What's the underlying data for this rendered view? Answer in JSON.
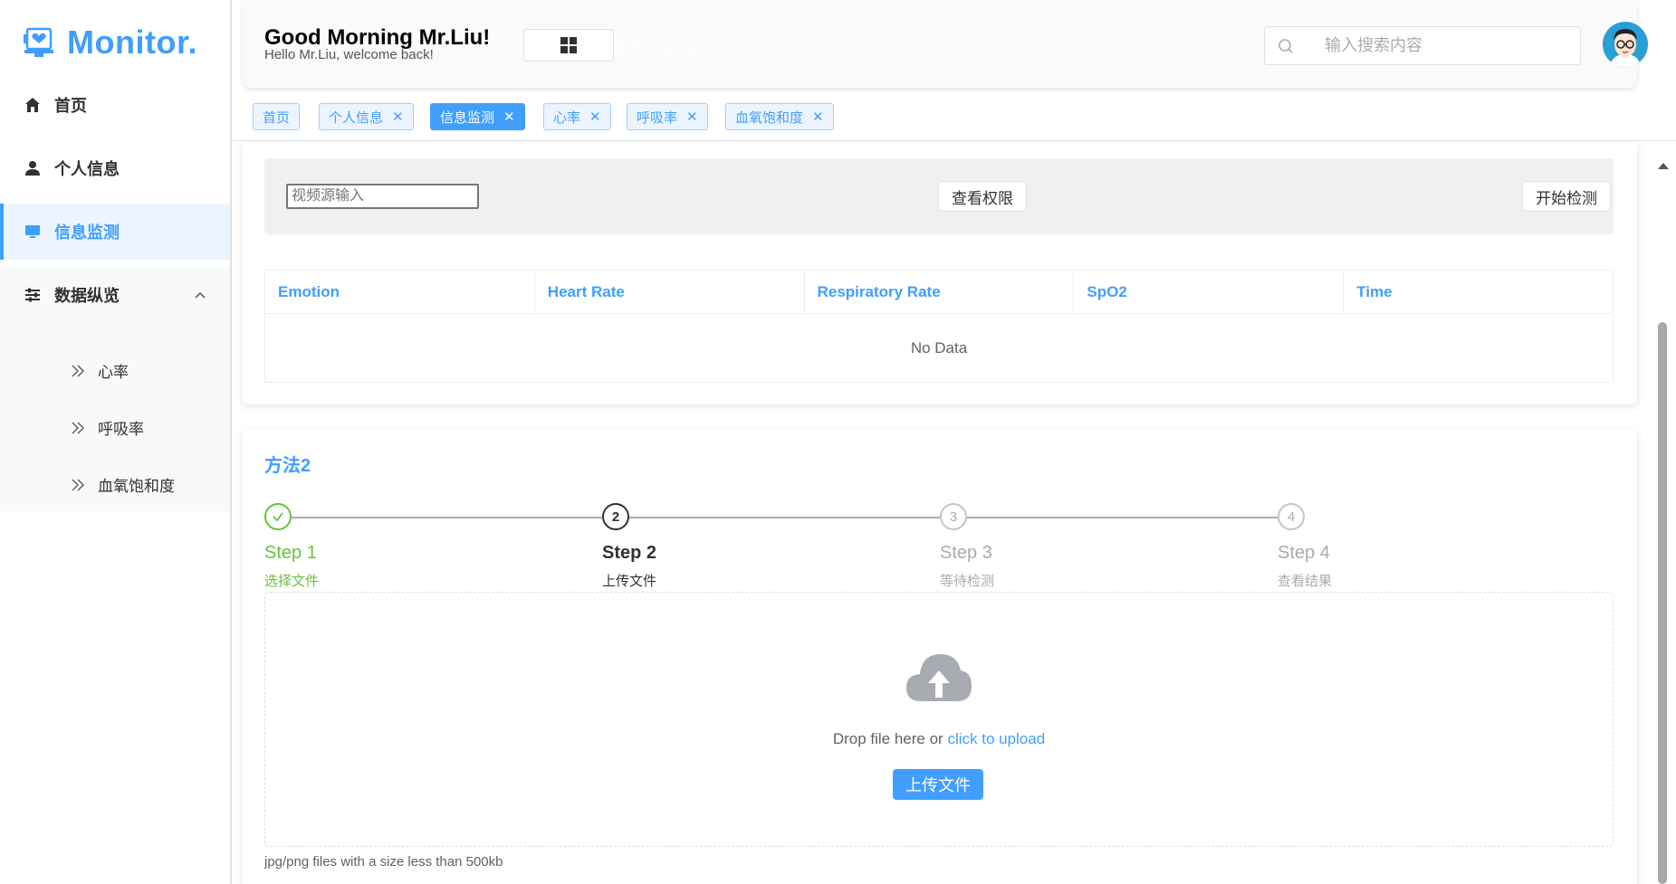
{
  "app": {
    "logo_text": "Monitor."
  },
  "sidebar": {
    "items": [
      {
        "label": "首页",
        "icon": "home-icon"
      },
      {
        "label": "个人信息",
        "icon": "user-icon"
      },
      {
        "label": "信息监测",
        "icon": "monitor-icon",
        "active": true
      },
      {
        "label": "数据纵览",
        "icon": "sliders-icon",
        "expanded": true
      }
    ],
    "subitems": [
      {
        "label": "心率"
      },
      {
        "label": "呼吸率"
      },
      {
        "label": "血氧饱和度"
      }
    ]
  },
  "header": {
    "greeting": "Good Morning Mr.Liu!",
    "subgreeting": "Hello Mr.Liu, welcome back!",
    "breadcrumb": "首页 / 信息监测",
    "search_placeholder": "输入搜索内容"
  },
  "tabs": [
    {
      "label": "首页",
      "closable": false
    },
    {
      "label": "个人信息",
      "closable": true
    },
    {
      "label": "信息监测",
      "closable": true,
      "active": true
    },
    {
      "label": "心率",
      "closable": true
    },
    {
      "label": "呼吸率",
      "closable": true
    },
    {
      "label": "血氧饱和度",
      "closable": true
    }
  ],
  "method1": {
    "video_placeholder": "视频源输入",
    "check_permission_label": "查看权限",
    "start_detection_label": "开始检测",
    "table": {
      "columns": [
        "Emotion",
        "Heart Rate",
        "Respiratory Rate",
        "SpO2",
        "Time"
      ],
      "empty_text": "No Data"
    }
  },
  "method2": {
    "title": "方法2",
    "steps": [
      {
        "title": "Step 1",
        "desc": "选择文件",
        "status": "done"
      },
      {
        "title": "Step 2",
        "desc": "上传文件",
        "status": "process",
        "number": "2"
      },
      {
        "title": "Step 3",
        "desc": "等待检测",
        "status": "wait",
        "number": "3"
      },
      {
        "title": "Step 4",
        "desc": "查看结果",
        "status": "wait",
        "number": "4"
      }
    ],
    "drop_text": "Drop file here or ",
    "drop_link": "click to upload",
    "upload_button": "上传文件",
    "tip": "jpg/png files with a size less than 500kb"
  },
  "colors": {
    "primary": "#409eff",
    "success": "#67c23a",
    "muted": "#a8abb2"
  }
}
